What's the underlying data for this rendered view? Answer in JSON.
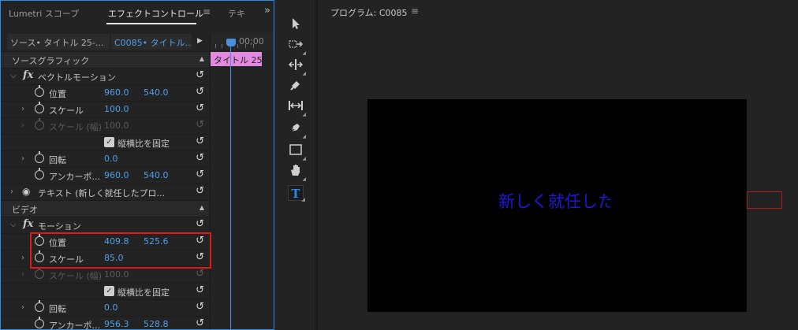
{
  "tabs": [
    {
      "label": "Lumetri スコープ"
    },
    {
      "label": "エフェクトコントロール",
      "active": true
    },
    {
      "label": "テキ"
    }
  ],
  "icons": {
    "menu": "≡",
    "expand": "»",
    "play": "▶",
    "twirl_open": "⌵",
    "twirl_closed": "›",
    "reset": "↺",
    "collapse": "▲",
    "eye": "◉",
    "check": "✓"
  },
  "clip_selector": {
    "source": "ソース• タイトル 25-...",
    "sequence": "C0085• タイトル..."
  },
  "timeline": {
    "timecode": "00;00",
    "clip_label": "タイトル 25"
  },
  "effects": {
    "source_graphic_header": "ソースグラフィック",
    "vector_motion": {
      "label": "ベクトルモーション",
      "position": {
        "label": "位置",
        "x": "960.0",
        "y": "540.0"
      },
      "scale": {
        "label": "スケール",
        "value": "100.0"
      },
      "scale_width": {
        "label": "スケール (幅)",
        "value": "100.0"
      },
      "uniform_scale": {
        "label": "縦横比を固定"
      },
      "rotation": {
        "label": "回転",
        "value": "0.0"
      },
      "anchor": {
        "label": "アンカーポ...",
        "x": "960.0",
        "y": "540.0"
      }
    },
    "text_layer": {
      "label": "テキスト (新しく就任したプロ..."
    },
    "video_header": "ビデオ",
    "motion": {
      "label": "モーション",
      "position": {
        "label": "位置",
        "x": "409.8",
        "y": "525.6"
      },
      "scale": {
        "label": "スケール",
        "value": "85.0"
      },
      "scale_width": {
        "label": "スケール (幅)",
        "value": "100.0"
      },
      "uniform_scale": {
        "label": "縦横比を固定"
      },
      "rotation": {
        "label": "回転",
        "value": "0.0"
      },
      "anchor": {
        "label": "アンカーポ...",
        "x": "956.3",
        "y": "528.8"
      }
    }
  },
  "tools": [
    "selection-tool",
    "track-select-tool",
    "ripple-edit-tool",
    "razor-tool",
    "slip-tool",
    "pen-tool",
    "rectangle-tool",
    "hand-tool",
    "type-tool"
  ],
  "program_monitor": {
    "title": "プログラム: C0085",
    "overlay_text": "新しく就任したプロ"
  },
  "colors": {
    "accent": "#2d8ceb",
    "value_blue": "#4f9fe8",
    "clip_pink": "#e38ae0",
    "highlight_red": "#e01a1a",
    "text_blue": "#1a1ad8"
  }
}
